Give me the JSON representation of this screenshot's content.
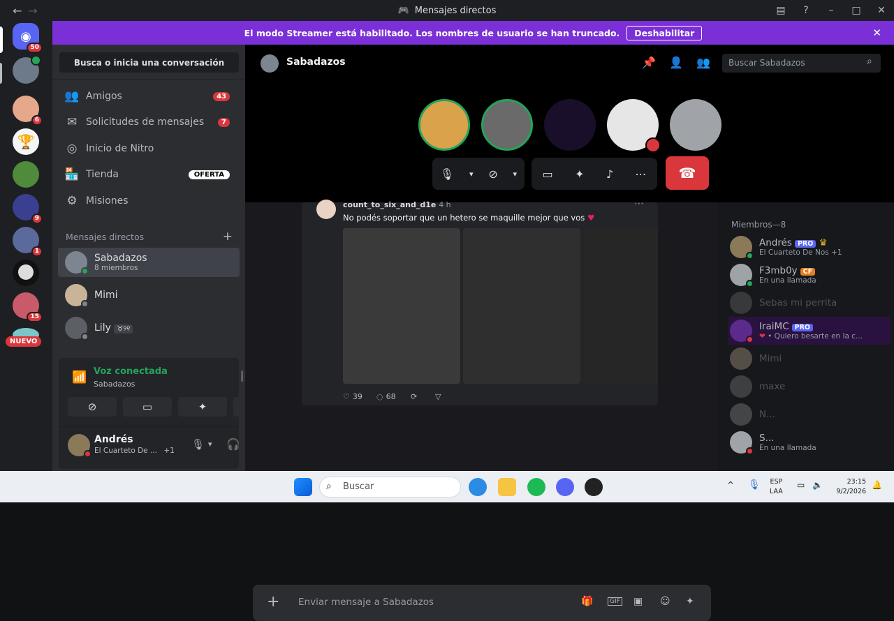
{
  "window": {
    "title": "Mensajes directos"
  },
  "banner": {
    "text": "El modo Streamer está habilitado. Los nombres de usuario se han truncado.",
    "button": "Deshabilitar"
  },
  "rail": {
    "badges": [
      "50",
      "6",
      "9",
      "1",
      "15"
    ],
    "new_label": "NUEVO"
  },
  "sidebar": {
    "search": "Busca o inicia una conversación",
    "nav": [
      {
        "label": "Amigos",
        "count": "43"
      },
      {
        "label": "Solicitudes de mensajes",
        "count": "7"
      },
      {
        "label": "Inicio de Nitro"
      },
      {
        "label": "Tienda",
        "tag": "OFERTA"
      },
      {
        "label": "Misiones"
      }
    ],
    "dm_header": "Mensajes directos",
    "dms": [
      {
        "name": "Sabadazos",
        "sub": "8 miembros"
      },
      {
        "name": "Mimi"
      },
      {
        "name": "Lily",
        "tag": "♉୨୧"
      }
    ]
  },
  "voice": {
    "title": "Voz conectada",
    "channel": "Sabadazos"
  },
  "user": {
    "name": "Andrés",
    "status": "El Cuarteto De ...",
    "extra": "+1"
  },
  "channel": {
    "name": "Sabadazos",
    "search_placeholder": "Buscar Sabadazos"
  },
  "embed": {
    "author": "count_to_six_and_d1e",
    "time": "4 h",
    "text": "No podés soportar que un hetero se maquille mejor que vos",
    "likes": "39",
    "replies": "68"
  },
  "composer": {
    "placeholder": "Enviar mensaje a Sabadazos"
  },
  "members": {
    "header": "Miembros—8",
    "list": [
      {
        "name": "Andrés",
        "tag": "PRO",
        "activity": "El Cuarteto De Nos +1",
        "online": true
      },
      {
        "name": "F3mb0y",
        "tag": "CF",
        "activity": "En una llamada",
        "online": true
      },
      {
        "name": "Sebas mi perrita",
        "activity": "",
        "online": false
      },
      {
        "name": "IraiMC",
        "tag": "PRO",
        "activity": "• Quiero besarte en la c...",
        "online": true
      },
      {
        "name": "Mimi",
        "activity": "",
        "online": false
      },
      {
        "name": "maxe",
        "activity": "",
        "online": false
      },
      {
        "name": "N...",
        "activity": "",
        "online": false
      },
      {
        "name": "S...",
        "activity": "En una llamada",
        "online": true
      }
    ]
  },
  "taskbar": {
    "search": "Buscar",
    "lang1": "ESP",
    "lang2": "LAA",
    "time": "23:15",
    "date": "9/2/2026"
  },
  "colors": {
    "accent": "#7b2fd6",
    "danger": "#da373c",
    "online": "#23a55a"
  }
}
